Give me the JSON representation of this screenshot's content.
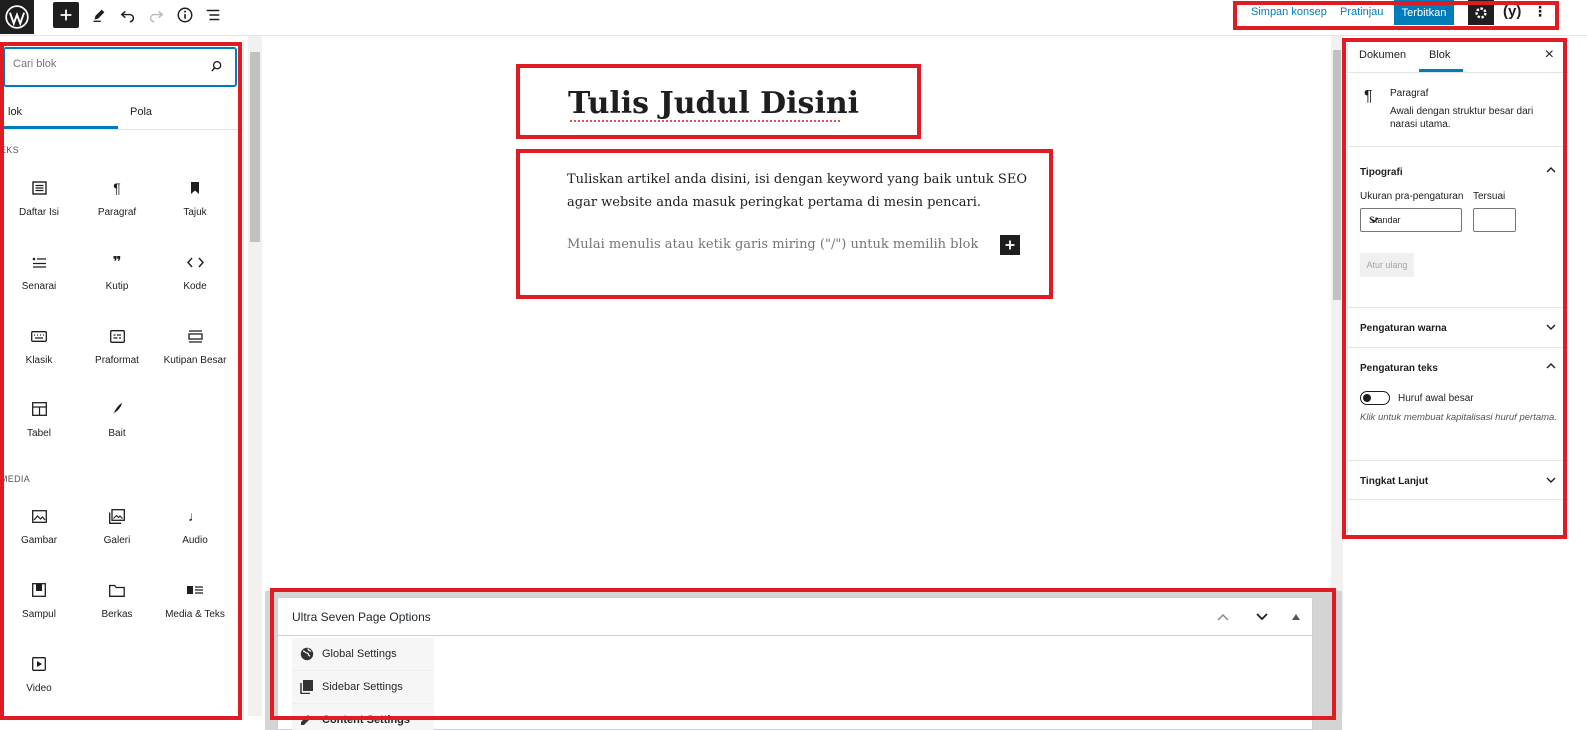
{
  "topbar": {
    "save_draft": "Simpan konsep",
    "preview": "Pratinjau",
    "publish": "Terbitkan",
    "yoast": "(y)",
    "more": "⋮"
  },
  "inserter": {
    "search_placeholder": "Cari blok",
    "tabs": [
      "lok",
      "Pola"
    ],
    "categories": [
      "EKS",
      "MEDIA"
    ],
    "text_blocks": [
      {
        "label": "Daftar Isi",
        "icon": "list-icon"
      },
      {
        "label": "Paragraf",
        "icon": "pilcrow-icon"
      },
      {
        "label": "Tajuk",
        "icon": "bookmark-icon"
      },
      {
        "label": "Senarai",
        "icon": "bullet-list-icon"
      },
      {
        "label": "Kutip",
        "icon": "quote-icon"
      },
      {
        "label": "Kode",
        "icon": "code-icon"
      },
      {
        "label": "Klasik",
        "icon": "keyboard-icon"
      },
      {
        "label": "Praformat",
        "icon": "preformatted-icon"
      },
      {
        "label": "Kutipan Besar",
        "icon": "pullquote-icon"
      },
      {
        "label": "Tabel",
        "icon": "table-icon"
      },
      {
        "label": "Bait",
        "icon": "verse-icon"
      }
    ],
    "media_blocks": [
      {
        "label": "Gambar",
        "icon": "image-icon"
      },
      {
        "label": "Galeri",
        "icon": "gallery-icon"
      },
      {
        "label": "Audio",
        "icon": "audio-icon"
      },
      {
        "label": "Sampul",
        "icon": "cover-icon"
      },
      {
        "label": "Berkas",
        "icon": "folder-icon"
      },
      {
        "label": "Media & Teks",
        "icon": "media-text-icon"
      },
      {
        "label": "Video",
        "icon": "video-icon"
      }
    ]
  },
  "editor": {
    "title": "Tulis Judul Disini",
    "paragraph": "Tuliskan artikel anda disini, isi dengan keyword yang baik untuk SEO agar website anda masuk peringkat pertama di mesin pencari.",
    "placeholder": "Mulai menulis atau ketik garis miring (\"/\") untuk memilih blok"
  },
  "metabox": {
    "title": "Ultra Seven Page Options",
    "items": [
      "Global Settings",
      "Sidebar Settings",
      "Content Settings"
    ]
  },
  "sidebar": {
    "tabs": [
      "Dokumen",
      "Blok"
    ],
    "close": "×",
    "block_name": "Paragraf",
    "block_desc": "Awali dengan struktur besar dari narasi utama.",
    "typography": "Tipografi",
    "preset_size_label": "Ukuran pra-pengaturan",
    "custom_label": "Tersuai",
    "preset_value": "Standar",
    "reset": "Atur ulang",
    "color_settings": "Pengaturan warna",
    "text_settings": "Pengaturan teks",
    "dropcap_label": "Huruf awal besar",
    "dropcap_help": "Klik untuk membuat kapitalisasi huruf pertama.",
    "advanced": "Tingkat Lanjut"
  },
  "colors": {
    "accent": "#007cba",
    "highlight": "#e01b24"
  }
}
